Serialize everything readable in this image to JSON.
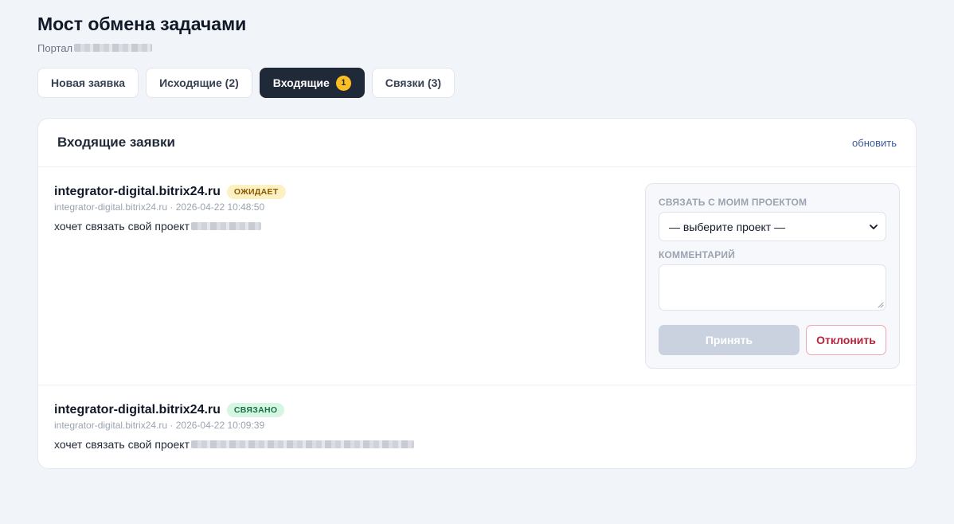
{
  "page": {
    "title": "Мост обмена задачами",
    "portal_label": "Портал"
  },
  "tabs": [
    {
      "label": "Новая заявка"
    },
    {
      "label": "Исходящие (2)"
    },
    {
      "label": "Входящие",
      "badge": "1",
      "active": true
    },
    {
      "label": "Связки (3)"
    }
  ],
  "card": {
    "title": "Входящие заявки",
    "refresh_label": "обновить"
  },
  "requests": [
    {
      "domain": "integrator-digital.bitrix24.ru",
      "status": "ОЖИДАЕТ",
      "meta": "integrator-digital.bitrix24.ru · 2026-04-22 10:48:50",
      "text": "хочет связать свой проект"
    },
    {
      "domain": "integrator-digital.bitrix24.ru",
      "status": "СВЯЗАНО",
      "meta": "integrator-digital.bitrix24.ru · 2026-04-22 10:09:39",
      "text": "хочет связать свой проект"
    }
  ],
  "panel": {
    "project_label": "СВЯЗАТЬ С МОИМ ПРОЕКТОМ",
    "project_placeholder": "— выберите проект —",
    "comment_label": "КОММЕНТАРИЙ",
    "accept_label": "Принять",
    "reject_label": "Отклонить"
  },
  "colors": {
    "accent_dark": "#1f2937",
    "badge": "#fbbf24",
    "pending_bg": "#fdf0c2",
    "linked_bg": "#d7f5e3",
    "reject": "#b4233c"
  },
  "icons": {
    "select_arrow": "chevron-down-icon",
    "resize": "resize-grip-icon"
  }
}
